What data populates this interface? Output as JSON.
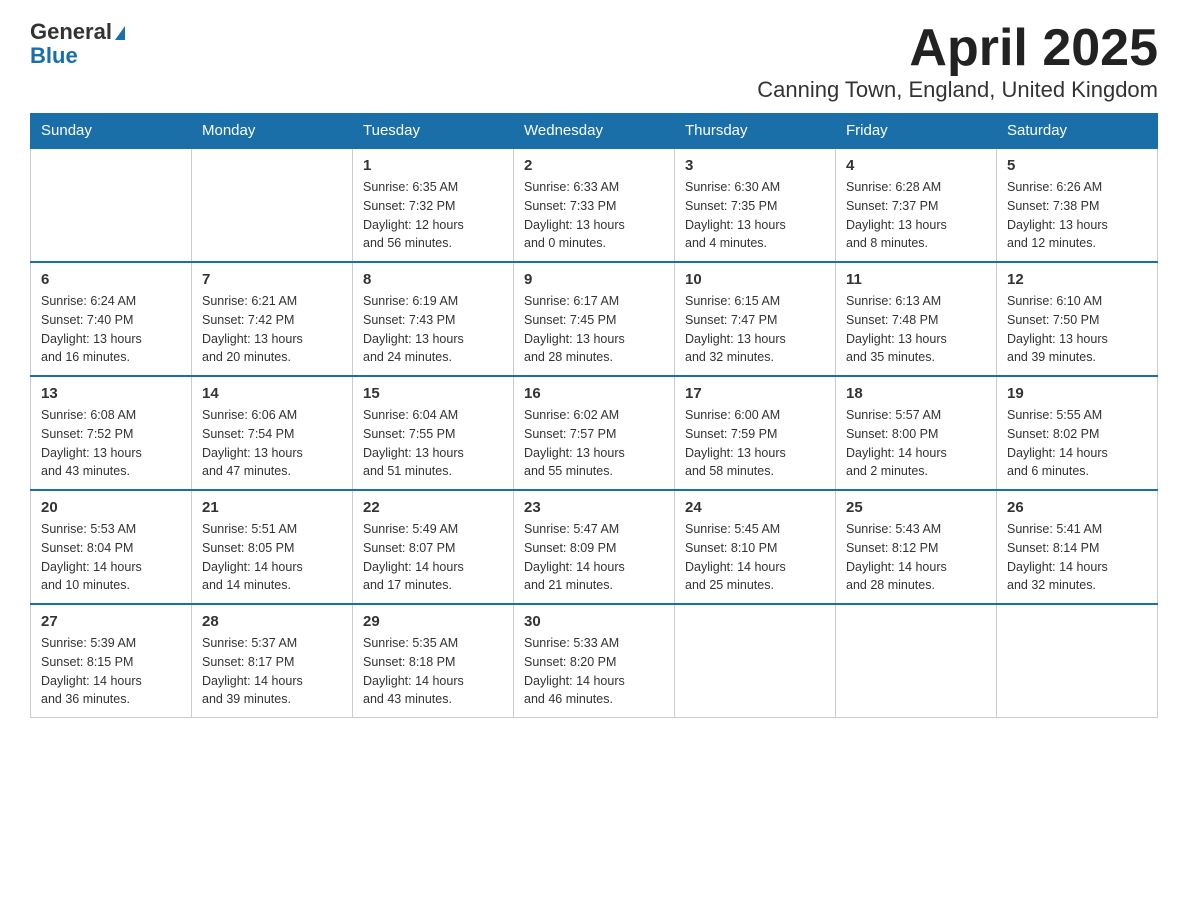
{
  "header": {
    "logo_general": "General",
    "logo_blue": "Blue",
    "title": "April 2025",
    "subtitle": "Canning Town, England, United Kingdom"
  },
  "days_of_week": [
    "Sunday",
    "Monday",
    "Tuesday",
    "Wednesday",
    "Thursday",
    "Friday",
    "Saturday"
  ],
  "weeks": [
    [
      {
        "day": "",
        "info": ""
      },
      {
        "day": "",
        "info": ""
      },
      {
        "day": "1",
        "info": "Sunrise: 6:35 AM\nSunset: 7:32 PM\nDaylight: 12 hours\nand 56 minutes."
      },
      {
        "day": "2",
        "info": "Sunrise: 6:33 AM\nSunset: 7:33 PM\nDaylight: 13 hours\nand 0 minutes."
      },
      {
        "day": "3",
        "info": "Sunrise: 6:30 AM\nSunset: 7:35 PM\nDaylight: 13 hours\nand 4 minutes."
      },
      {
        "day": "4",
        "info": "Sunrise: 6:28 AM\nSunset: 7:37 PM\nDaylight: 13 hours\nand 8 minutes."
      },
      {
        "day": "5",
        "info": "Sunrise: 6:26 AM\nSunset: 7:38 PM\nDaylight: 13 hours\nand 12 minutes."
      }
    ],
    [
      {
        "day": "6",
        "info": "Sunrise: 6:24 AM\nSunset: 7:40 PM\nDaylight: 13 hours\nand 16 minutes."
      },
      {
        "day": "7",
        "info": "Sunrise: 6:21 AM\nSunset: 7:42 PM\nDaylight: 13 hours\nand 20 minutes."
      },
      {
        "day": "8",
        "info": "Sunrise: 6:19 AM\nSunset: 7:43 PM\nDaylight: 13 hours\nand 24 minutes."
      },
      {
        "day": "9",
        "info": "Sunrise: 6:17 AM\nSunset: 7:45 PM\nDaylight: 13 hours\nand 28 minutes."
      },
      {
        "day": "10",
        "info": "Sunrise: 6:15 AM\nSunset: 7:47 PM\nDaylight: 13 hours\nand 32 minutes."
      },
      {
        "day": "11",
        "info": "Sunrise: 6:13 AM\nSunset: 7:48 PM\nDaylight: 13 hours\nand 35 minutes."
      },
      {
        "day": "12",
        "info": "Sunrise: 6:10 AM\nSunset: 7:50 PM\nDaylight: 13 hours\nand 39 minutes."
      }
    ],
    [
      {
        "day": "13",
        "info": "Sunrise: 6:08 AM\nSunset: 7:52 PM\nDaylight: 13 hours\nand 43 minutes."
      },
      {
        "day": "14",
        "info": "Sunrise: 6:06 AM\nSunset: 7:54 PM\nDaylight: 13 hours\nand 47 minutes."
      },
      {
        "day": "15",
        "info": "Sunrise: 6:04 AM\nSunset: 7:55 PM\nDaylight: 13 hours\nand 51 minutes."
      },
      {
        "day": "16",
        "info": "Sunrise: 6:02 AM\nSunset: 7:57 PM\nDaylight: 13 hours\nand 55 minutes."
      },
      {
        "day": "17",
        "info": "Sunrise: 6:00 AM\nSunset: 7:59 PM\nDaylight: 13 hours\nand 58 minutes."
      },
      {
        "day": "18",
        "info": "Sunrise: 5:57 AM\nSunset: 8:00 PM\nDaylight: 14 hours\nand 2 minutes."
      },
      {
        "day": "19",
        "info": "Sunrise: 5:55 AM\nSunset: 8:02 PM\nDaylight: 14 hours\nand 6 minutes."
      }
    ],
    [
      {
        "day": "20",
        "info": "Sunrise: 5:53 AM\nSunset: 8:04 PM\nDaylight: 14 hours\nand 10 minutes."
      },
      {
        "day": "21",
        "info": "Sunrise: 5:51 AM\nSunset: 8:05 PM\nDaylight: 14 hours\nand 14 minutes."
      },
      {
        "day": "22",
        "info": "Sunrise: 5:49 AM\nSunset: 8:07 PM\nDaylight: 14 hours\nand 17 minutes."
      },
      {
        "day": "23",
        "info": "Sunrise: 5:47 AM\nSunset: 8:09 PM\nDaylight: 14 hours\nand 21 minutes."
      },
      {
        "day": "24",
        "info": "Sunrise: 5:45 AM\nSunset: 8:10 PM\nDaylight: 14 hours\nand 25 minutes."
      },
      {
        "day": "25",
        "info": "Sunrise: 5:43 AM\nSunset: 8:12 PM\nDaylight: 14 hours\nand 28 minutes."
      },
      {
        "day": "26",
        "info": "Sunrise: 5:41 AM\nSunset: 8:14 PM\nDaylight: 14 hours\nand 32 minutes."
      }
    ],
    [
      {
        "day": "27",
        "info": "Sunrise: 5:39 AM\nSunset: 8:15 PM\nDaylight: 14 hours\nand 36 minutes."
      },
      {
        "day": "28",
        "info": "Sunrise: 5:37 AM\nSunset: 8:17 PM\nDaylight: 14 hours\nand 39 minutes."
      },
      {
        "day": "29",
        "info": "Sunrise: 5:35 AM\nSunset: 8:18 PM\nDaylight: 14 hours\nand 43 minutes."
      },
      {
        "day": "30",
        "info": "Sunrise: 5:33 AM\nSunset: 8:20 PM\nDaylight: 14 hours\nand 46 minutes."
      },
      {
        "day": "",
        "info": ""
      },
      {
        "day": "",
        "info": ""
      },
      {
        "day": "",
        "info": ""
      }
    ]
  ]
}
